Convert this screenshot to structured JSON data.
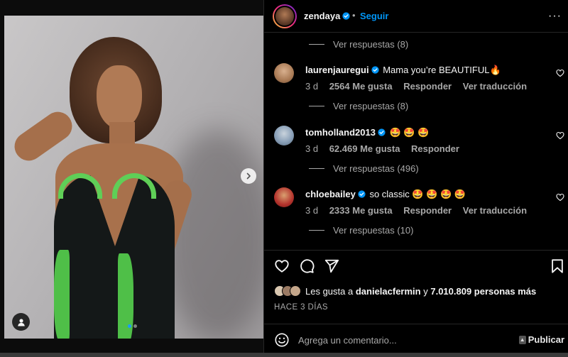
{
  "header": {
    "username": "zendaya",
    "separator": "•",
    "follow_label": "Seguir",
    "more_label": "···"
  },
  "replies": [
    {
      "label": "Ver respuestas (8)"
    },
    {
      "label": "Ver respuestas (8)"
    },
    {
      "label": "Ver respuestas (496)"
    },
    {
      "label": "Ver respuestas (10)"
    }
  ],
  "comments": [
    {
      "user": "laurenjauregui",
      "text": "Mama you’re BEAUTIFUL🔥",
      "time": "3 d",
      "likes": "2564 Me gusta",
      "reply": "Responder",
      "translate": "Ver traducción",
      "avatar_color": "#c49a72"
    },
    {
      "user": "tomholland2013",
      "text": "🤩 🤩 🤩",
      "time": "3 d",
      "likes": "62.469 Me gusta",
      "reply": "Responder",
      "avatar_color": "#8aa0b8"
    },
    {
      "user": "chloebailey",
      "text": "so classic 🤩 🤩 🤩 🤩",
      "time": "3 d",
      "likes": "2333 Me gusta",
      "reply": "Responder",
      "translate": "Ver traducción",
      "avatar_color": "#b3322c"
    }
  ],
  "likes": {
    "prefix": "Les gusta a",
    "first_user": "danielacfermin",
    "connector": "y",
    "others": "7.010.809 personas más"
  },
  "date": "HACE 3 DÍAS",
  "comment_box": {
    "placeholder": "Agrega un comentario...",
    "publish_label": "Publicar"
  },
  "icons": {
    "heart": "heart-icon",
    "comment": "comment-icon",
    "share": "share-icon",
    "save": "bookmark-icon",
    "emoji": "emoji-icon",
    "next": "chevron-right-icon",
    "user_tag": "user-icon"
  },
  "colors": {
    "accent": "#0095f6",
    "verified": "#0095f6",
    "background": "#000000",
    "muted_text": "#a8a8a8"
  }
}
